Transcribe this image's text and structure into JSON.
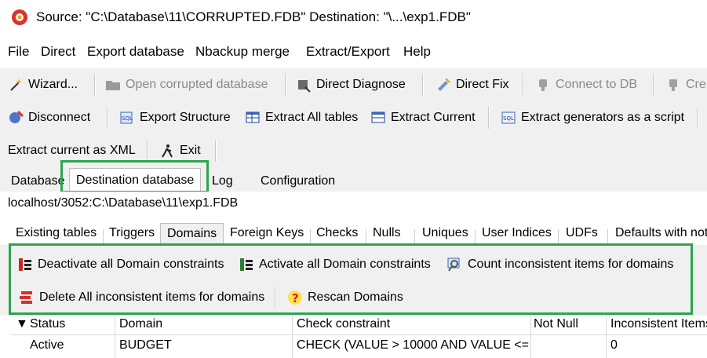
{
  "window": {
    "title": "Source: \"C:\\Database\\11\\CORRUPTED.FDB\" Destination: \"\\...\\exp1.FDB\""
  },
  "menu": {
    "items": [
      "File",
      "Direct",
      "Export database",
      "Nbackup merge",
      "Extract/Export",
      "Help"
    ]
  },
  "toolbar1": {
    "wizard": "Wizard...",
    "open_corrupted": "Open corrupted database",
    "direct_diagnose": "Direct Diagnose",
    "direct_fix": "Direct Fix",
    "connect_db": "Connect to DB",
    "create": "Cre"
  },
  "toolbar2": {
    "disconnect": "Disconnect",
    "export_structure": "Export Structure",
    "extract_all": "Extract All tables",
    "extract_current": "Extract Current",
    "extract_generators": "Extract generators as a script"
  },
  "toolbar3": {
    "extract_xml": "Extract current as XML",
    "exit": "Exit"
  },
  "tabs": [
    "Database",
    "Destination database",
    "Log",
    "Configuration"
  ],
  "destination": {
    "path": "localhost/3052:C:\\Database\\11\\exp1.FDB"
  },
  "subtabs": [
    "Existing tables",
    "Triggers",
    "Domains",
    "Foreign Keys",
    "Checks",
    "Nulls",
    "Uniques",
    "User Indices",
    "UDFs",
    "Defaults with not"
  ],
  "domain_actions": {
    "deactivate": "Deactivate all Domain constraints",
    "activate": "Activate all  Domain constraints",
    "count": "Count inconsistent items for domains",
    "delete": "Delete All inconsistent items for domains",
    "rescan": "Rescan Domains"
  },
  "grid": {
    "headers": [
      "Status",
      "Domain",
      "Check constraint",
      "Not Null",
      "Inconsistent Items"
    ],
    "rows": [
      {
        "status": "Active",
        "domain": "BUDGET",
        "check": "CHECK (VALUE > 10000 AND VALUE <=",
        "not_null": "",
        "inconsistent": "0"
      }
    ]
  },
  "colors": {
    "highlight": "#2ea44f",
    "disabled_text": "#8a8a8a"
  }
}
